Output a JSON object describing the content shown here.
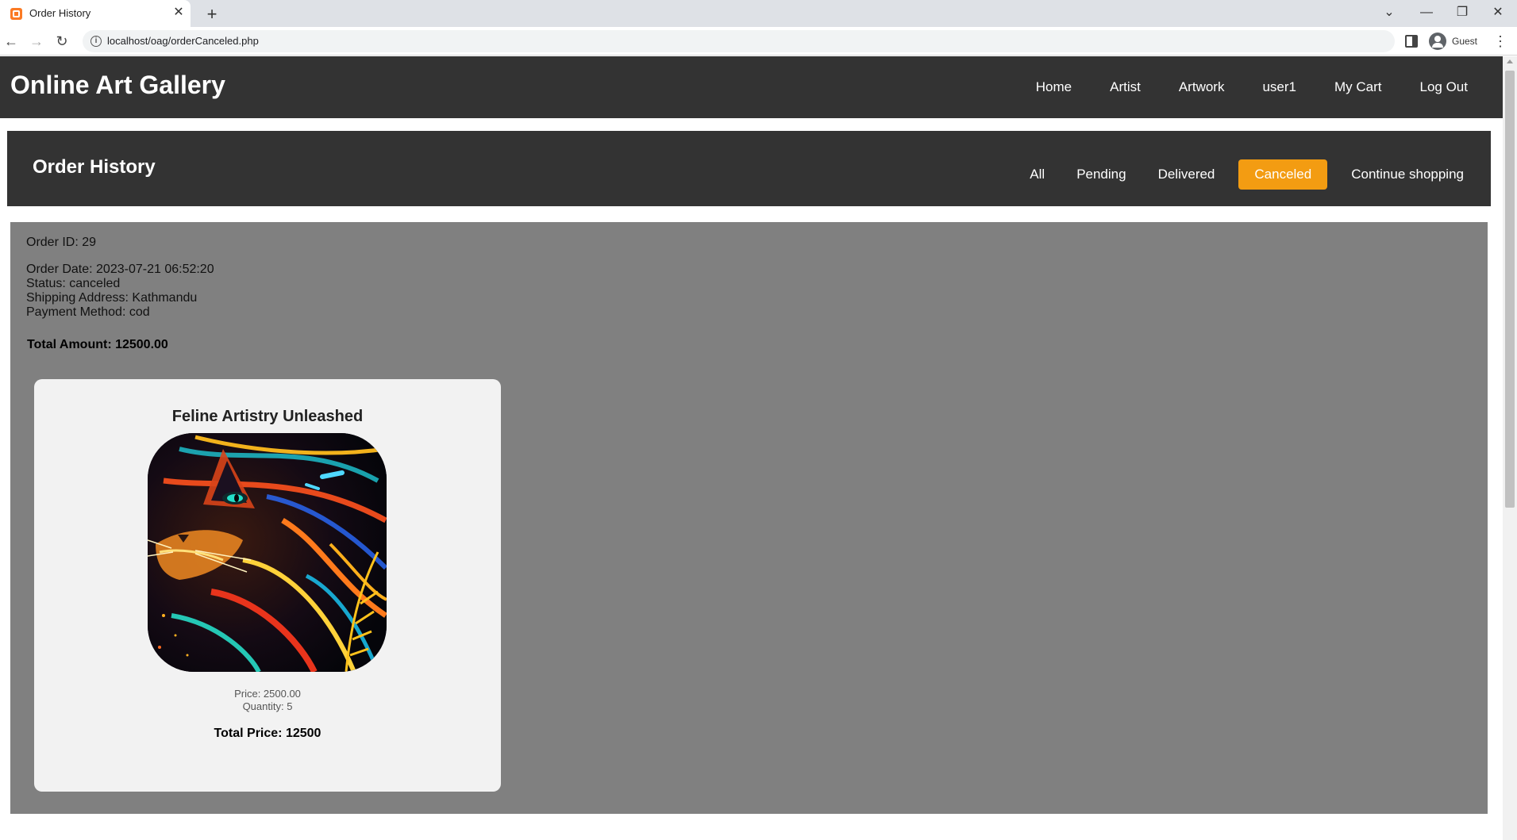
{
  "browser": {
    "tab_title": "Order History",
    "url": "localhost/oag/orderCanceled.php",
    "profile_label": "Guest"
  },
  "site": {
    "logo": "Online Art Gallery",
    "nav": [
      "Home",
      "Artist",
      "Artwork",
      "user1",
      "My Cart",
      "Log Out"
    ]
  },
  "order_page": {
    "title": "Order History",
    "filters": [
      "All",
      "Pending",
      "Delivered",
      "Canceled",
      "Continue shopping"
    ],
    "active_filter": "Canceled",
    "active_color": "#f39c12"
  },
  "order": {
    "id_line": "Order ID: 29",
    "date_line": "Order Date: 2023-07-21 06:52:20",
    "status_line": "Status: canceled",
    "address_line": "Shipping Address: Kathmandu",
    "payment_line": "Payment Method: cod",
    "total_line": "Total Amount: 12500.00"
  },
  "item": {
    "name": "Feline Artistry Unleashed",
    "image_icon": "cat-artwork-image",
    "price_line": "Price: 2500.00",
    "quantity_line": "Quantity: 5",
    "total_line": "Total Price: 12500"
  },
  "colors": {
    "header_bg": "#333333",
    "panel_bg": "#808080",
    "card_bg": "#f2f2f2"
  }
}
